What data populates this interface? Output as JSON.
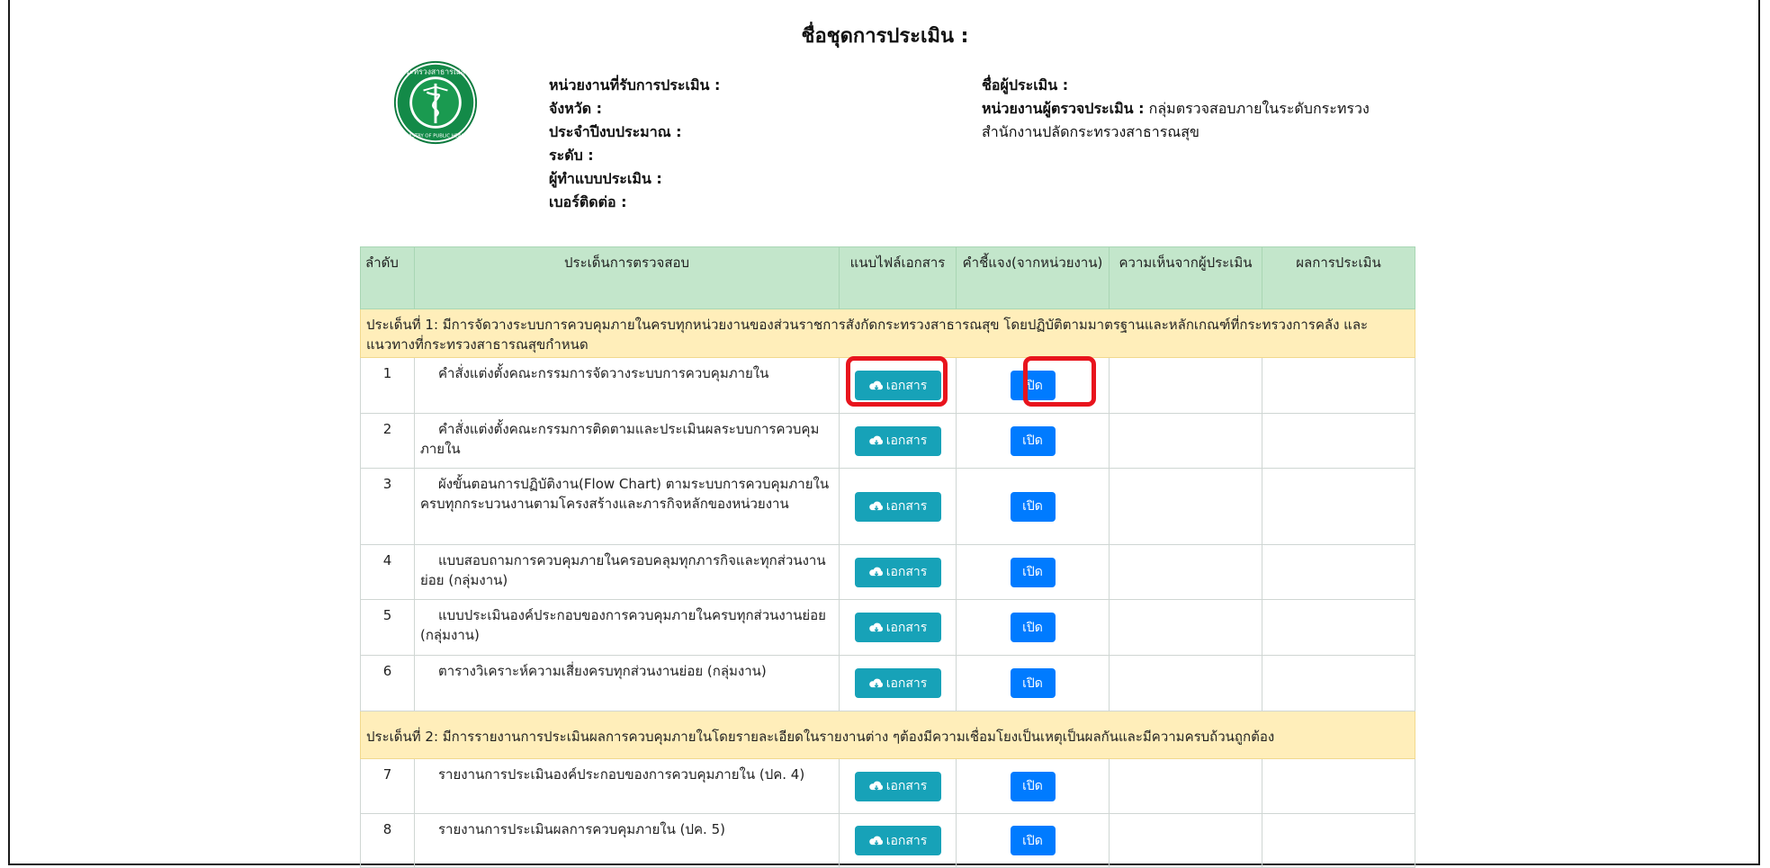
{
  "header": {
    "title": "ชื่อชุดการประเมิน :"
  },
  "logo": {
    "top_text": "กระทรวงสาธารณสุข",
    "bottom_text": "MINISTRY OF PUBLIC HEALTH"
  },
  "info_left": [
    "หน่วยงานที่รับการประเมิน :",
    "จังหวัด :",
    "ประจำปีงบประมาณ :",
    "ระดับ :",
    "ผู้ทำแบบประเมิน :",
    "เบอร์ติดต่อ :"
  ],
  "info_right": {
    "assessor_label": "ชื่อผู้ประเมิน :",
    "unit_label": "หน่วยงานผู้ตรวจประเมิน :",
    "unit_value": "กลุ่มตรวจสอบภายในระดับกระทรวง สำนักงานปลัดกระทรวงสาธารณสุข"
  },
  "table": {
    "headers": [
      "ลำดับ",
      "ประเด็นการตรวจสอบ",
      "แนบไฟล์เอกสาร",
      "คำชี้แจง(จากหน่วยงาน)",
      "ความเห็นจากผู้ประเมิน",
      "ผลการประเมิน"
    ],
    "doc_button_label": "เอกสาร",
    "open_button_label": "เปิด",
    "sections": [
      {
        "title": "ประเด็นที่ 1: มีการจัดวางระบบการควบคุมภายในครบทุกหน่วยงานของส่วนราชการสังกัดกระทรวงสาธารณสุข โดยปฏิบัติตามมาตรฐานและหลักเกณฑ์ที่กระทรวงการคลัง และแนวทางที่กระทรวงสาธารณสุขกำหนด",
        "items": [
          {
            "no": "1",
            "text": "คำสั่งแต่งตั้งคณะกรรมการจัดวางระบบการควบคุมภายใน"
          },
          {
            "no": "2",
            "text": "คำสั่งแต่งตั้งคณะกรรมการติดตามและประเมินผลระบบการควบคุมภายใน"
          },
          {
            "no": "3",
            "text": "ผังขั้นตอนการปฏิบัติงาน(Flow Chart) ตามระบบการควบคุมภายในครบทุกกระบวนงานตามโครงสร้างและภารกิจหลักของหน่วยงาน"
          },
          {
            "no": "4",
            "text": "แบบสอบถามการควบคุมภายในครอบคลุมทุกภารกิจและทุกส่วนงานย่อย (กลุ่มงาน)"
          },
          {
            "no": "5",
            "text": "แบบประเมินองค์ประกอบของการควบคุมภายในครบทุกส่วนงานย่อย (กลุ่มงาน)"
          },
          {
            "no": "6",
            "text": "ตารางวิเคราะห์ความเสี่ยงครบทุกส่วนงานย่อย (กลุ่มงาน)"
          }
        ]
      },
      {
        "title": "ประเด็นที่ 2: มีการรายงานการประเมินผลการควบคุมภายในโดยรายละเอียดในรายงานต่าง ๆต้องมีความเชื่อมโยงเป็นเหตุเป็นผลกันและมีความครบถ้วนถูกต้อง",
        "items": [
          {
            "no": "7",
            "text": "รายงานการประเมินองค์ประกอบของการควบคุมภายใน (ปค. 4)"
          },
          {
            "no": "8",
            "text": "รายงานการประเมินผลการควบคุมภายใน (ปค. 5)"
          }
        ]
      }
    ]
  },
  "colors": {
    "header_bg": "#c3e6cb",
    "section_bg": "#ffeeba",
    "doc_button": "#17a2b8",
    "open_button": "#007bff",
    "highlight": "#e8141d"
  }
}
